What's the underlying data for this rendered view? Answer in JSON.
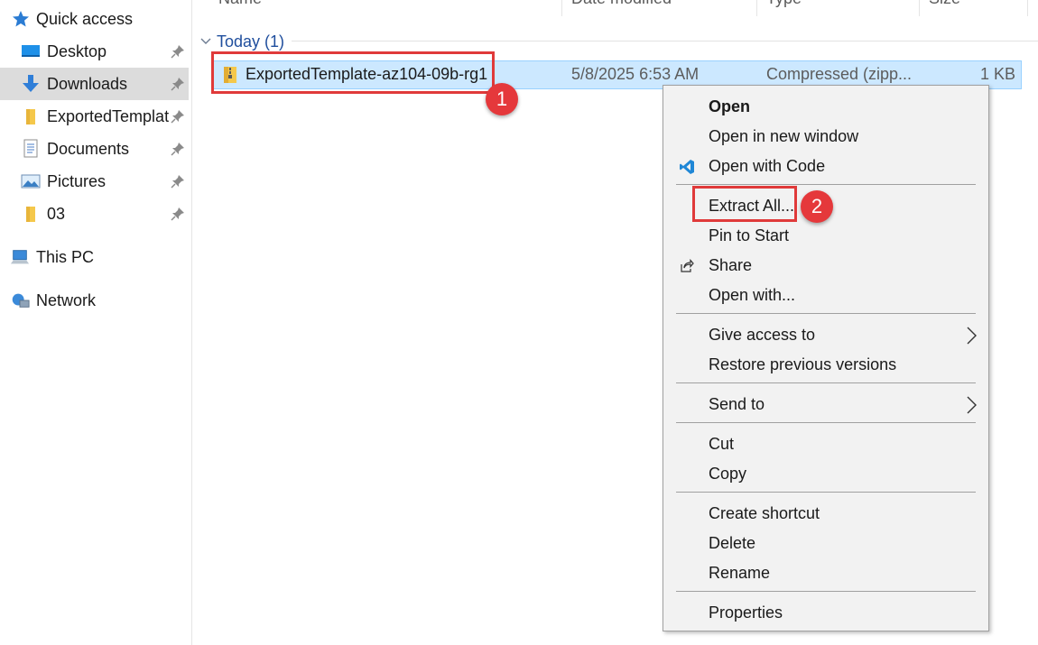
{
  "columns": {
    "name": "Name",
    "date": "Date modified",
    "type": "Type",
    "size": "Size"
  },
  "sidebar": {
    "quick_access": "Quick access",
    "items": [
      {
        "label": "Desktop",
        "icon": "desktop-icon",
        "pinned": true
      },
      {
        "label": "Downloads",
        "icon": "download-arrow-icon",
        "pinned": true,
        "selected": true
      },
      {
        "label": "ExportedTemplat",
        "icon": "folder-icon",
        "pinned": true
      },
      {
        "label": "Documents",
        "icon": "documents-icon",
        "pinned": true
      },
      {
        "label": "Pictures",
        "icon": "pictures-icon",
        "pinned": true
      },
      {
        "label": "03",
        "icon": "folder-icon",
        "pinned": true
      }
    ],
    "this_pc": "This PC",
    "network": "Network"
  },
  "group": {
    "label": "Today (1)"
  },
  "file": {
    "name": "ExportedTemplate-az104-09b-rg1",
    "date": "5/8/2025 6:53 AM",
    "type": "Compressed (zipp...",
    "size": "1 KB"
  },
  "badges": {
    "step1": "1",
    "step2": "2"
  },
  "menu": {
    "open": "Open",
    "open_new_window": "Open in new window",
    "open_with_code": "Open with Code",
    "extract_all": "Extract All...",
    "pin_to_start": "Pin to Start",
    "share": "Share",
    "open_with": "Open with...",
    "give_access": "Give access to",
    "restore_versions": "Restore previous versions",
    "send_to": "Send to",
    "cut": "Cut",
    "copy": "Copy",
    "create_shortcut": "Create shortcut",
    "delete": "Delete",
    "rename": "Rename",
    "properties": "Properties"
  },
  "colors": {
    "selection": "#cce8ff",
    "annotation_red": "#e03a3a",
    "group_blue": "#1f4e9d",
    "vscode_blue": "#1f87d6"
  }
}
